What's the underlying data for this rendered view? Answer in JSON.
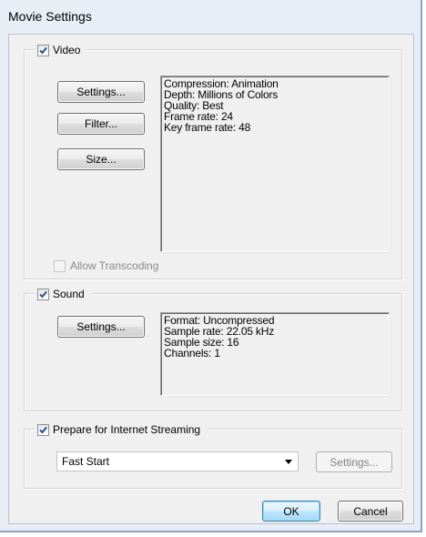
{
  "window": {
    "title": "Movie Settings"
  },
  "video": {
    "label": "Video",
    "checked": true,
    "buttons": {
      "settings": "Settings...",
      "filter": "Filter...",
      "size": "Size..."
    },
    "info": [
      "Compression: Animation",
      "Depth: Millions of Colors",
      "Quality: Best",
      "Frame rate: 24",
      "Key frame rate: 48"
    ],
    "allow_transcoding": {
      "label": "Allow Transcoding",
      "checked": false,
      "enabled": false
    }
  },
  "sound": {
    "label": "Sound",
    "checked": true,
    "buttons": {
      "settings": "Settings..."
    },
    "info": [
      "Format: Uncompressed",
      "Sample rate: 22.05 kHz",
      "Sample size: 16",
      "Channels: 1"
    ]
  },
  "streaming": {
    "label": "Prepare for Internet Streaming",
    "checked": true,
    "selected_option": "Fast Start",
    "settings_label": "Settings...",
    "settings_enabled": false
  },
  "footer": {
    "ok_label": "OK",
    "cancel_label": "Cancel"
  },
  "colors": {
    "title_bar": "#e9eef6",
    "dialog_background": "#f0f0f0",
    "default_button_border": "#3c7fb1"
  },
  "icons": {
    "checkmark": "checkmark-icon",
    "dropdown": "chevron-down-icon"
  }
}
